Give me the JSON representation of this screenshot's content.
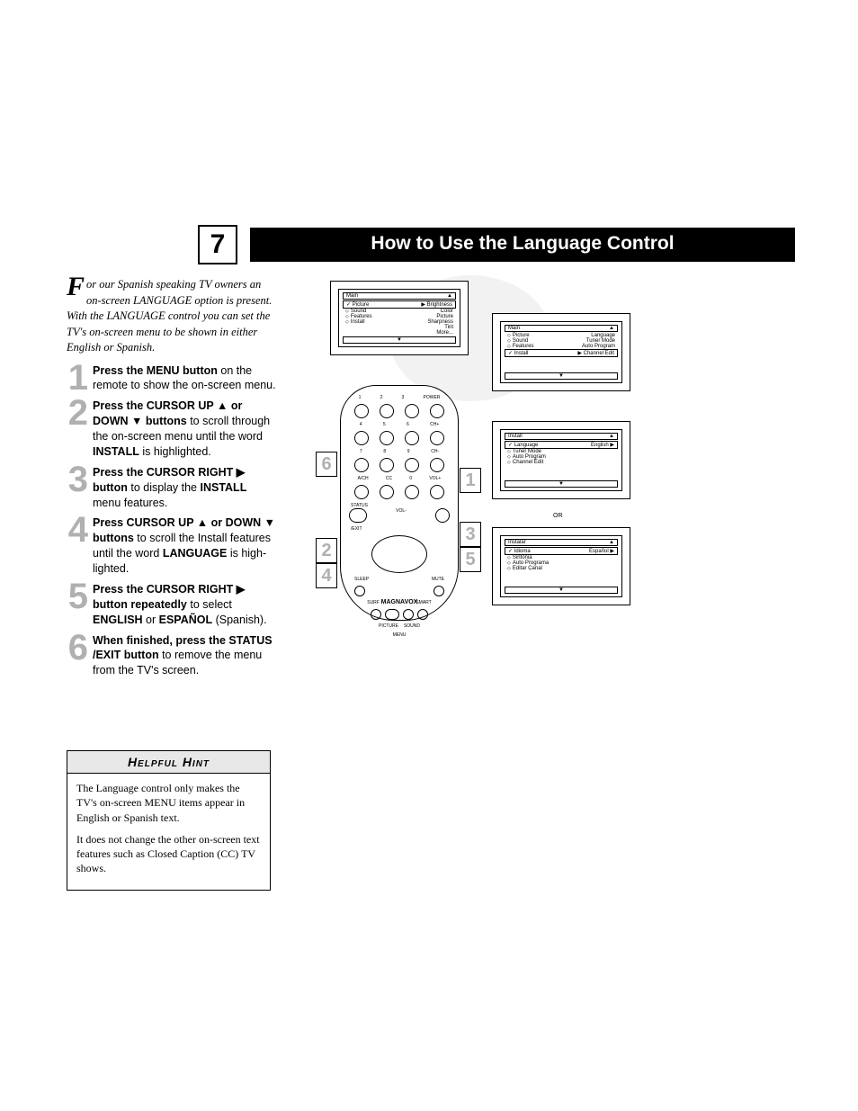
{
  "page_number": "7",
  "title": "How to Use the Language Control",
  "intro_first": "F",
  "intro": "or our Spanish speaking TV owners an on-screen LANGUAGE option is present. With the LANGUAGE control you can set the TV's on-screen menu to be shown in either English or Spanish.",
  "steps": {
    "s1": {
      "n": "1",
      "html": "<b>Press the MENU button</b> on the remote to show the on-screen menu."
    },
    "s2": {
      "n": "2",
      "html": "<b>Press the CURSOR UP ▲ or DOWN ▼ buttons</b> to scroll through the on-screen menu until the word <b>INSTALL</b> is highlighted."
    },
    "s3": {
      "n": "3",
      "html": "<b>Press the CURSOR RIGHT ▶ button</b> to display the <b>INSTALL</b> menu features."
    },
    "s4": {
      "n": "4",
      "html": "<b>Press CURSOR UP ▲ or DOWN ▼ buttons</b> to scroll the Install features until the word <b>LANGUAGE</b> is high-lighted."
    },
    "s5": {
      "n": "5",
      "html": "<b>Press the CURSOR RIGHT ▶ button repeatedly</b> to select <b>ENGLISH</b> or <b>ESPAÑOL</b> (Spanish)."
    },
    "s6": {
      "n": "6",
      "html": "<b>When finished, press the STATUS /EXIT button</b> to remove the menu from the TV's screen."
    }
  },
  "callouts": {
    "c1": "1",
    "c2": "2",
    "c3": "3",
    "c4": "4",
    "c5": "5",
    "c6": "6"
  },
  "remote": {
    "brand": "MAGNAVOX",
    "labels": {
      "power": "POWER",
      "ch": "CH+",
      "vol": "VOL+",
      "a": "A/CH",
      "cc": "CC",
      "status": "STATUS",
      "exit": "/EXIT",
      "sleep": "SLEEP",
      "mute": "MUTE",
      "surf": "SURF",
      "menu": "MENU",
      "smart": "SMART",
      "picture": "PICTURE",
      "sound": "SOUND"
    }
  },
  "screens": {
    "main_picture": {
      "title": "Main",
      "up": "▲",
      "selected": "Picture",
      "sel_arrow": "▶",
      "sel_right": "Brightness",
      "rows": [
        [
          "Sound",
          "Color"
        ],
        [
          "Features",
          "Picture"
        ],
        [
          "Install",
          "Sharpness"
        ],
        [
          "",
          "Tint"
        ],
        [
          "",
          "More..."
        ]
      ],
      "down": "▼"
    },
    "main_install": {
      "title": "Main",
      "up": "▲",
      "rows_pre": [
        [
          "Picture",
          "Language"
        ],
        [
          "Sound",
          "Tuner Mode"
        ],
        [
          "Features",
          "Auto Program"
        ]
      ],
      "selected": "Install",
      "sel_arrow": "▶",
      "sel_right": "Channel Edit",
      "down": "▼"
    },
    "install_en": {
      "title": "Install",
      "up": "▲",
      "selected": "Language",
      "sel_right": "English",
      "sel_arrow": "▶",
      "rows": [
        [
          "Tuner Mode",
          ""
        ],
        [
          "Auto Program",
          ""
        ],
        [
          "Channel Edit",
          ""
        ]
      ],
      "down": "▼"
    },
    "install_es": {
      "title": "Instalar",
      "up": "▲",
      "selected": "Idioma",
      "sel_right": "Español",
      "sel_arrow": "▶",
      "rows": [
        [
          "Sintonia",
          ""
        ],
        [
          "Auto Programa",
          ""
        ],
        [
          "Editar Canal",
          ""
        ]
      ],
      "down": "▼"
    },
    "or": "OR"
  },
  "hint": {
    "title": "Helpful Hint",
    "p1": "The Language control only makes the TV's on-screen MENU items appear in English or Spanish text.",
    "p2": "It does not change the other on-screen text features such as Closed Caption (CC) TV shows."
  }
}
